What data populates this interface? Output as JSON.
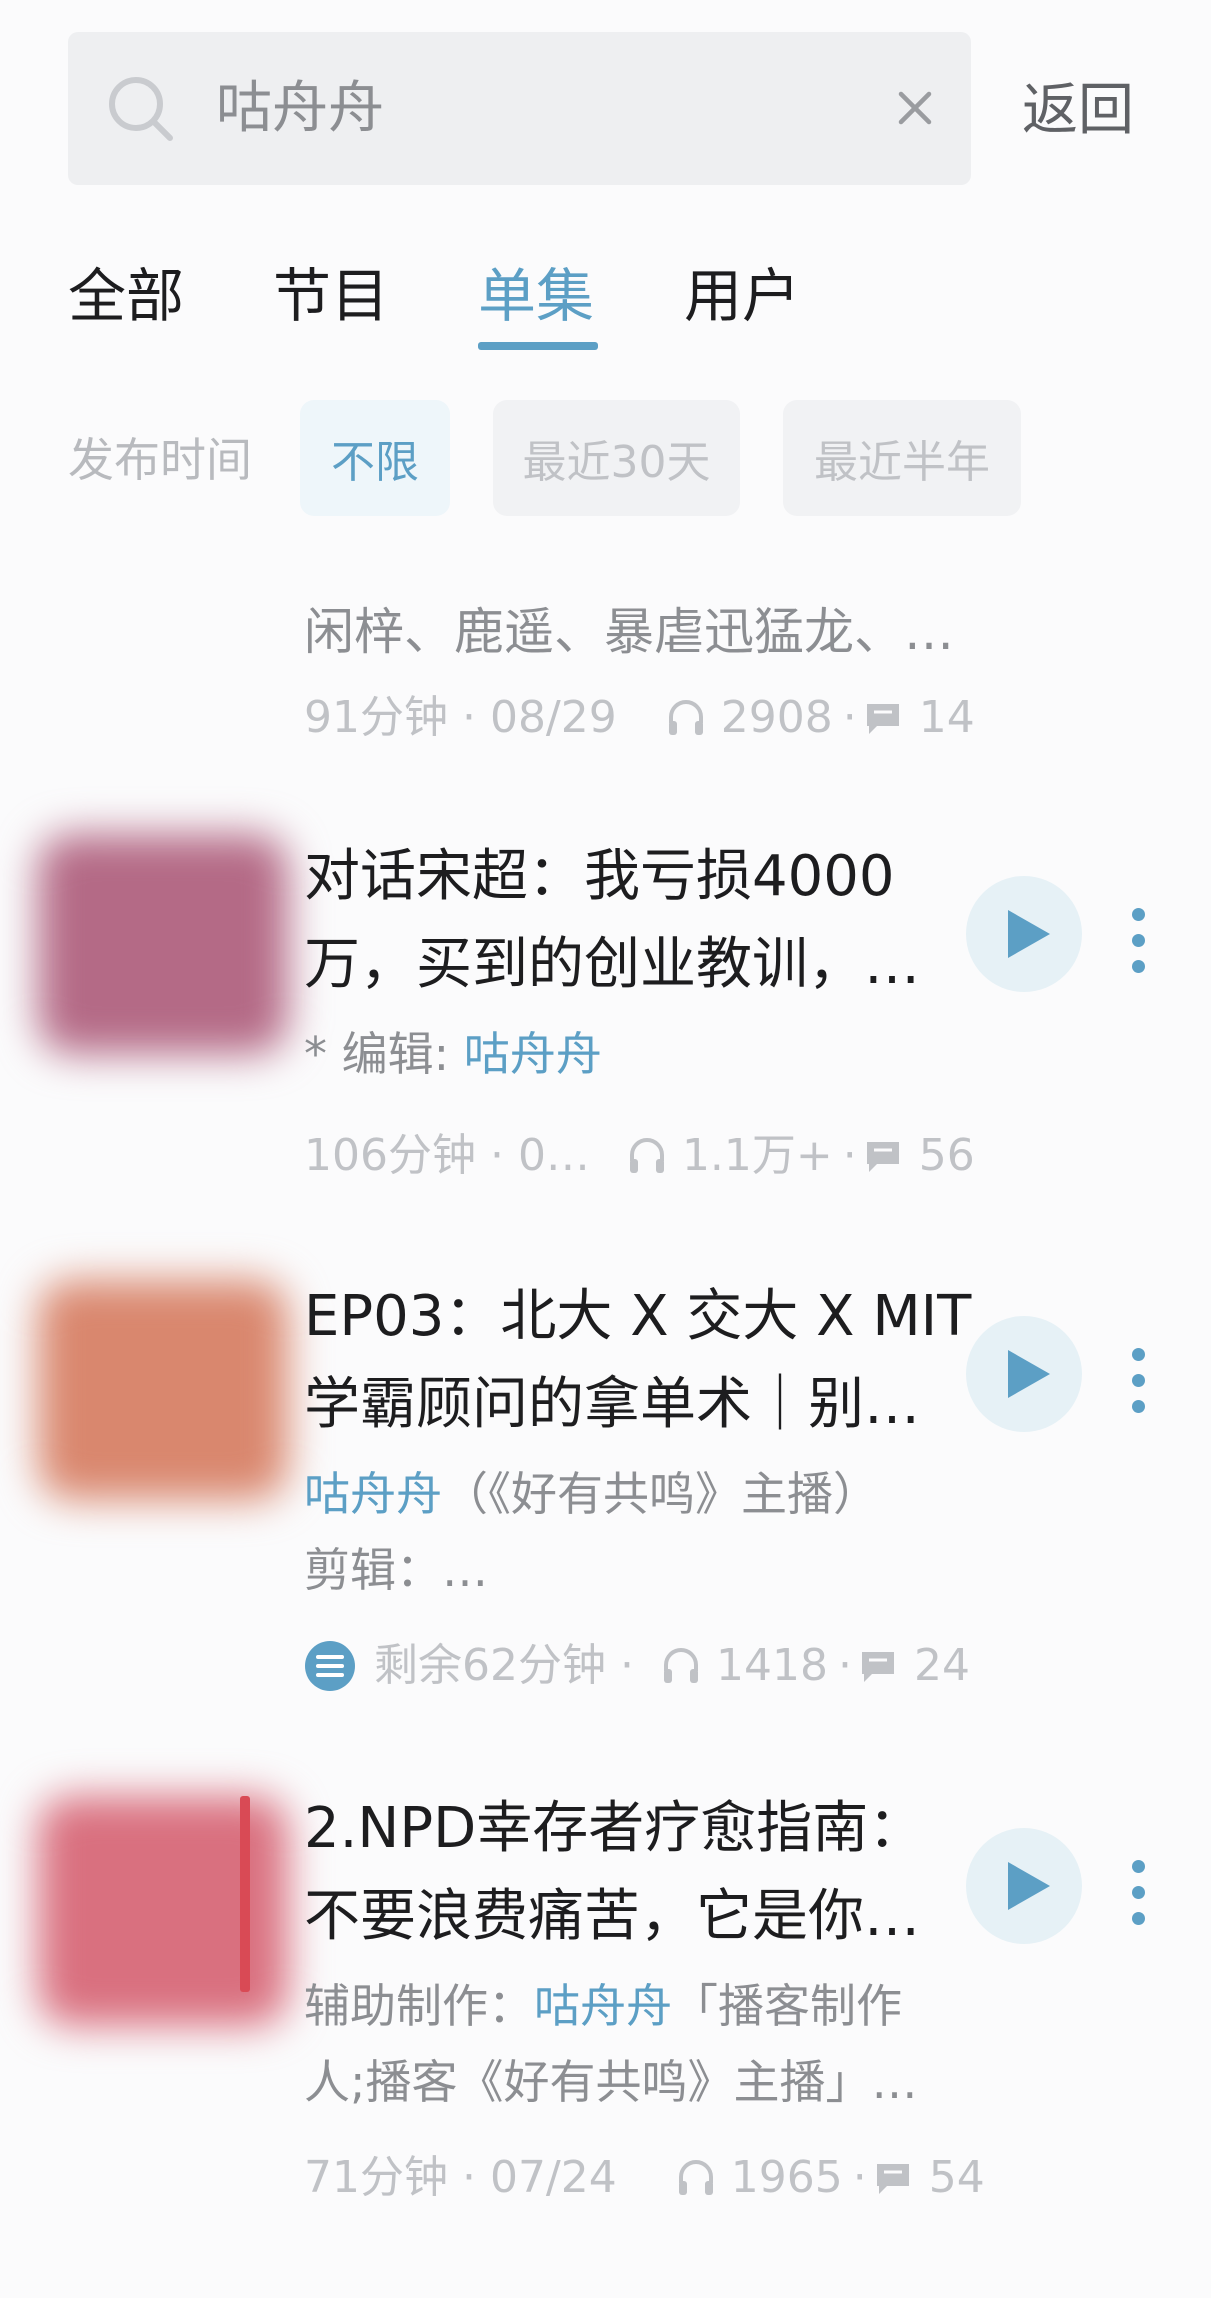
{
  "search": {
    "query": "咕舟舟",
    "back_label": "返回"
  },
  "tabs": [
    {
      "label": "全部"
    },
    {
      "label": "节目"
    },
    {
      "label": "单集",
      "active": true
    },
    {
      "label": "用户"
    }
  ],
  "filter": {
    "label": "发布时间",
    "options": [
      {
        "label": "不限",
        "active": true
      },
      {
        "label": "最近30天"
      },
      {
        "label": "最近半年"
      }
    ]
  },
  "episodes": [
    {
      "sub_text": "闲梓、鹿遥、暴虐迅猛龙、…",
      "duration_date": "91分钟 · 08/29",
      "plays": "2908",
      "comments": "14"
    },
    {
      "title_line1": "对话宋超：我亏损4000",
      "title_line2": "万，买到的创业教训，…",
      "sub_prefix": "* 编辑: ",
      "sub_highlight": "咕舟舟",
      "duration_date": "106分钟 · 0…",
      "plays": "1.1万+",
      "comments": "56",
      "thumb_color": "#b46a86"
    },
    {
      "title_line1": "EP03：北大 X 交大 X MIT",
      "title_line2": "学霸顾问的拿单术｜别…",
      "sub_highlight": "咕舟舟",
      "sub_suffix": "（《好有共鸣》主播）",
      "sub_line2": "剪辑：…",
      "duration_date": "剩余62分钟 ·",
      "plays": "1418",
      "comments": "24",
      "thumb_color": "#d9876e"
    },
    {
      "title_line1": "2.NPD幸存者疗愈指南：",
      "title_line2": "不要浪费痛苦，它是你…",
      "sub_prefix": "辅助制作：",
      "sub_highlight": "咕舟舟",
      "sub_suffix": "「播客制作",
      "sub_line2": "人;播客《好有共鸣》主播」…",
      "duration_date": "71分钟 · 07/24",
      "plays": "1965",
      "comments": "54",
      "thumb_color": "#d9707f"
    }
  ],
  "colors": {
    "accent": "#5c9fc5",
    "muted": "#c0c2c6",
    "text": "#1d1d1f"
  },
  "icons": [
    "search-icon",
    "clear-icon",
    "headphones-icon",
    "comment-icon",
    "play-icon",
    "more-icon",
    "playlist-icon"
  ]
}
